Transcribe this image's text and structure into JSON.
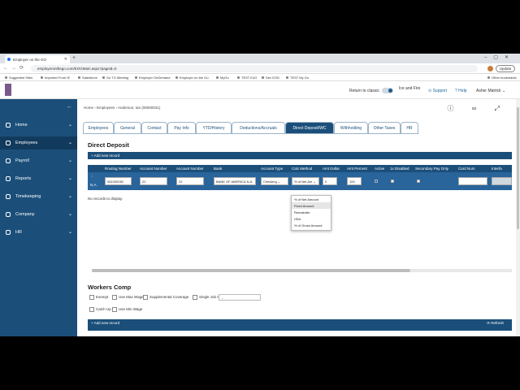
{
  "browser": {
    "tab_title": "Employer on the GO",
    "url": "employeronthego.com/EOGMain.aspx?pageid=0",
    "update_label": "Update",
    "bookmarks": [
      "Suggested Sites",
      "Imported From IE",
      "Salesforce",
      "Go TO Meeting",
      "Employer OnDemand",
      "Employer on the Go",
      "MyGo",
      "TEST EoG",
      "Dev EOD",
      "TEST My Go",
      "Other bookmarks"
    ]
  },
  "header": {
    "return_classic": "Return to classic",
    "company": "Ice and Fire",
    "support": "Support",
    "help": "Help",
    "user": "Asher Matrick"
  },
  "sidebar": {
    "items": [
      {
        "label": "Home"
      },
      {
        "label": "Employees"
      },
      {
        "label": "Payroll"
      },
      {
        "label": "Reports"
      },
      {
        "label": "Timekeeping"
      },
      {
        "label": "Company"
      },
      {
        "label": "HR"
      }
    ]
  },
  "breadcrumb": {
    "home": "Home",
    "employees": "Employees",
    "current": "Anderson, Ian (00000031)"
  },
  "tabs": [
    "Employees",
    "General",
    "Contact",
    "Pay Info",
    "YTD/History",
    "Deductions/Accruals",
    "Direct Deposit/WC",
    "Withholding",
    "Other Taxes",
    "HR"
  ],
  "direct_deposit": {
    "title": "Direct Deposit",
    "add_label": "Add new record",
    "columns": [
      "Routing Number",
      "Account Number",
      "Account Number",
      "Bank",
      "Account Type",
      "Calc Method",
      "Amt Dollar",
      "Amt Percent",
      "Active",
      "1x Disabled",
      "Secondary Pay Only",
      "Card Num",
      "Interfa"
    ],
    "row": {
      "routing": "061000052",
      "account": "22",
      "account_confirm": "22",
      "bank": "BANK OF AMERICA N.A.",
      "account_type": "Checking",
      "calc_method": "% of Net Am",
      "amt_dollar": "0",
      "amt_percent": "100"
    },
    "row_icons": {
      "edit": "⋮",
      "cancel": "N.A."
    },
    "calc_options": [
      "% of Net Amount",
      "Fixed Amount",
      "Remainder",
      "HSA",
      "% of Gross Amount"
    ],
    "no_records": "No records to display."
  },
  "workers_comp": {
    "title": "Workers Comp",
    "options": [
      "Exempt",
      "Use Max Wage",
      "Supplemental Coverage",
      "Catch Up",
      "Use Min Wage"
    ],
    "single_job_class": "Single Job Class",
    "add_label": "Add new record",
    "refresh_label": "Refresh"
  }
}
